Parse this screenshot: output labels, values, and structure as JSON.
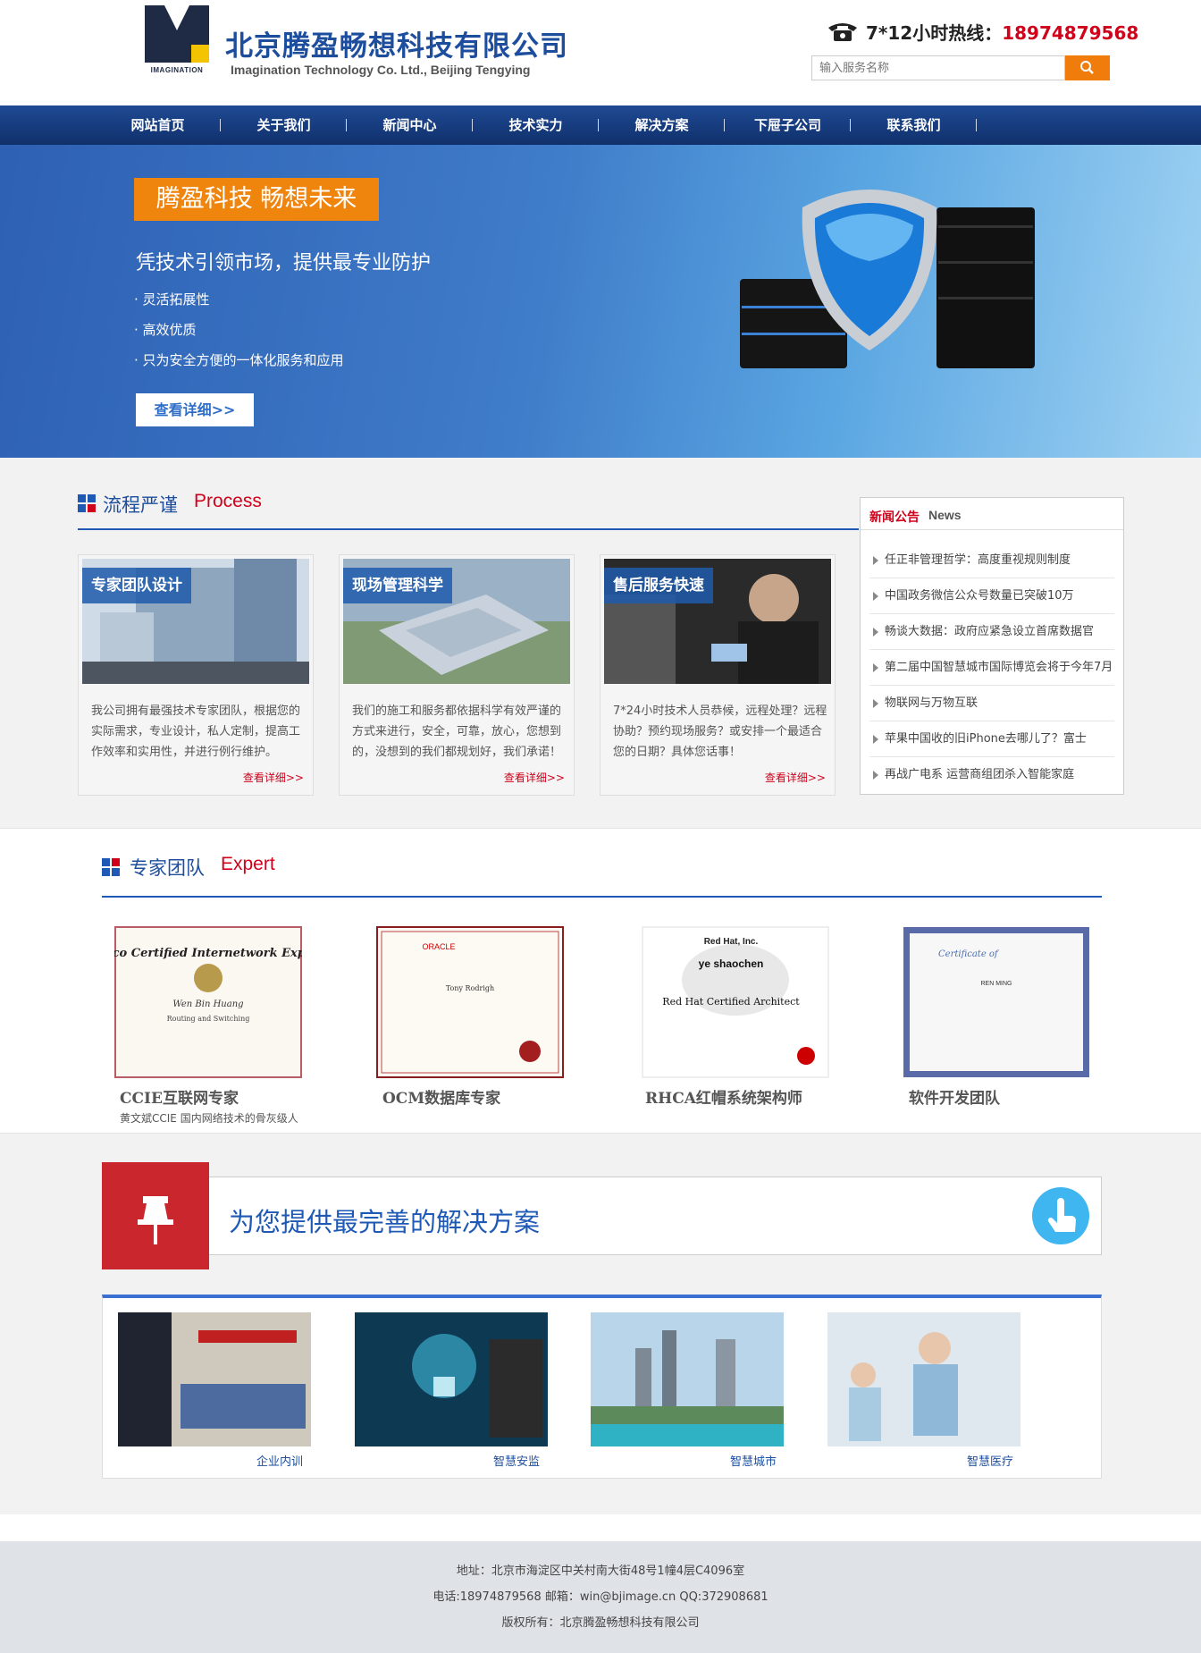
{
  "header": {
    "logo_text": "IMAGINATION",
    "company_cn": "北京腾盈畅想科技有限公司",
    "company_en": "Imagination Technology Co. Ltd., Beijing Tengying",
    "hotline_label": "7*12小时热线：",
    "hotline_number": "18974879568",
    "search_placeholder": "输入服务名称"
  },
  "nav": [
    "网站首页",
    "关于我们",
    "新闻中心",
    "技术实力",
    "解决方案",
    "下屉子公司",
    "联系我们"
  ],
  "banner": {
    "tag": "腾盈科技  畅想未来",
    "headline": "凭技术引领市场，提供最专业防护",
    "points": [
      "· 灵活拓展性",
      "· 高效优质",
      "· 只为安全方便的一体化服务和应用"
    ],
    "button": "查看详细>>"
  },
  "process": {
    "title_cn": "流程严谨",
    "title_en": "Process",
    "cards": [
      {
        "label": "专家团队设计",
        "text": "我公司拥有最强技术专家团队，根据您的实际需求，专业设计，私人定制，提高工作效率和实用性，并进行例行维护。",
        "more": "查看详细>>"
      },
      {
        "label": "现场管理科学",
        "text": "我们的施工和服务都依据科学有效严谨的方式来进行，安全，可靠，放心，您想到的，没想到的我们都规划好，我们承诺！",
        "more": "查看详细>>"
      },
      {
        "label": "售后服务快速",
        "text": "7*24小时技术人员恭候，远程处理？远程协助？预约现场服务？或安排一个最适合您的日期？具体您话事！",
        "more": "查看详细>>"
      }
    ]
  },
  "news": {
    "title_cn": "新闻公告",
    "title_en": "News",
    "items": [
      "任正非管理哲学：高度重视规则制度",
      "中国政务微信公众号数量已突破10万",
      "畅谈大数据：政府应紧急设立首席数据官",
      "第二届中国智慧城市国际博览会将于今年7月",
      "物联网与万物互联",
      "苹果中国收的旧iPhone去哪儿了？富士",
      "再战广电系 运营商组团杀入智能家庭"
    ]
  },
  "expert": {
    "title_cn": "专家团队",
    "title_en": "Expert",
    "certs": [
      {
        "name": "CCIE互联网专家",
        "cert_title": "Cisco Certified Internetwork Expert",
        "holder": "Wen Bin Huang",
        "track": "Routing and Switching"
      },
      {
        "name": "OCM数据库专家",
        "cert_title": "ORACLE",
        "holder": "Tony Rodrigh",
        "track": ""
      },
      {
        "name": "RHCA红帽系统架构师",
        "cert_title": "Red Hat, Inc.",
        "holder": "ye shaochen",
        "track": "Red Hat Certified Architect"
      },
      {
        "name": "软件开发团队",
        "cert_title": "Certificate of",
        "holder": "REN MING",
        "track": ""
      }
    ],
    "desc": "黄文斌CCIE 国内网络技术的骨灰级人"
  },
  "solutions": {
    "title": "为您提供最完善的解决方案",
    "items": [
      "企业内训",
      "智慧安监",
      "智慧城市",
      "智慧医疗"
    ]
  },
  "footer": {
    "address": "地址：北京市海淀区中关村南大街48号1幢4层C4096室",
    "contact": "电话:18974879568  邮箱：win@bjimage.cn QQ:372908681",
    "copyright": "版权所有：北京腾盈畅想科技有限公司"
  },
  "colors": {
    "brand_blue": "#1d4e9e",
    "accent_red": "#d0021b",
    "orange": "#f0850e"
  }
}
